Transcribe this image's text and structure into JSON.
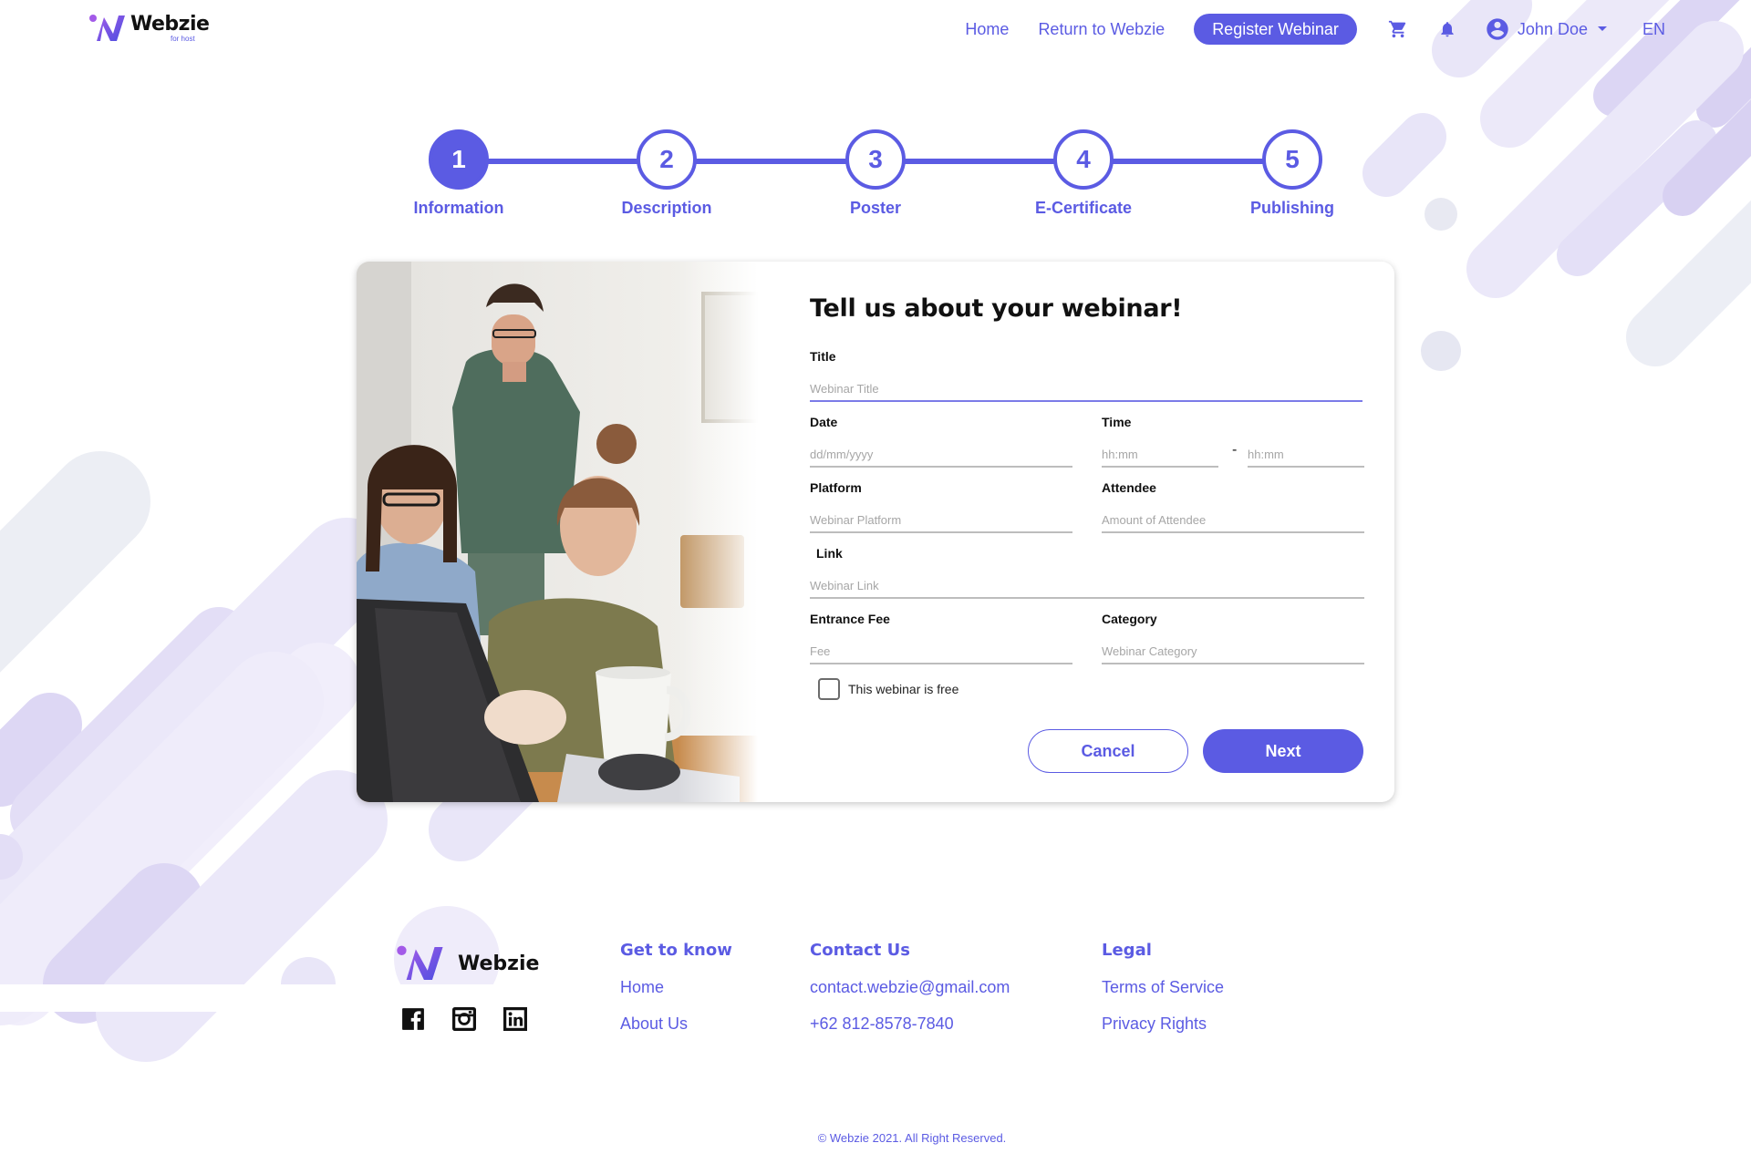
{
  "header": {
    "logo_name": "Webzie",
    "logo_sub": "for host",
    "nav_home": "Home",
    "nav_return": "Return to Webzie",
    "register_button": "Register Webinar",
    "user_name": "John Doe",
    "language": "EN",
    "icons": [
      "cart-icon",
      "bell-icon",
      "user-circle-icon",
      "caret-down-icon"
    ]
  },
  "stepper": {
    "steps": [
      {
        "number": "1",
        "label": "Information",
        "active": true
      },
      {
        "number": "2",
        "label": "Description",
        "active": false
      },
      {
        "number": "3",
        "label": "Poster",
        "active": false
      },
      {
        "number": "4",
        "label": "E-Certificate",
        "active": false
      },
      {
        "number": "5",
        "label": "Publishing",
        "active": false
      }
    ]
  },
  "form": {
    "heading": "Tell us about your webinar!",
    "title": {
      "label": "Title",
      "placeholder": "Webinar Title",
      "value": ""
    },
    "date": {
      "label": "Date",
      "placeholder": "dd/mm/yyyy",
      "value": ""
    },
    "time": {
      "label": "Time",
      "start_placeholder": "hh:mm",
      "end_placeholder": "hh:mm",
      "separator": "-"
    },
    "platform": {
      "label": "Platform",
      "placeholder": "Webinar Platform",
      "value": ""
    },
    "attendee": {
      "label": "Attendee",
      "placeholder": "Amount of Attendee",
      "value": ""
    },
    "link": {
      "label": "Link",
      "placeholder": "Webinar Link",
      "value": ""
    },
    "fee": {
      "label": "Entrance Fee",
      "placeholder": "Fee",
      "value": ""
    },
    "category": {
      "label": "Category",
      "placeholder": "Webinar Category",
      "value": ""
    },
    "free_checkbox": {
      "label": "This webinar is free",
      "checked": false
    },
    "cancel_button": "Cancel",
    "next_button": "Next"
  },
  "footer": {
    "brand": "Webzie",
    "social_icons": [
      "facebook-icon",
      "instagram-icon",
      "linkedin-icon"
    ],
    "get_to_know": {
      "heading": "Get to know",
      "links": [
        "Home",
        "About Us"
      ]
    },
    "contact": {
      "heading": "Contact Us",
      "email": "contact.webzie@gmail.com",
      "phone": "+62 812-8578-7840"
    },
    "legal": {
      "heading": "Legal",
      "links": [
        "Terms of Service",
        "Privacy Rights"
      ]
    },
    "copyright": "© Webzie 2021. All Right Reserved."
  },
  "colors": {
    "accent": "#5b5be3",
    "deco_light": "#ebe8f9",
    "deco_mid": "#ddd8f4",
    "deco_grey": "#eceef4"
  }
}
